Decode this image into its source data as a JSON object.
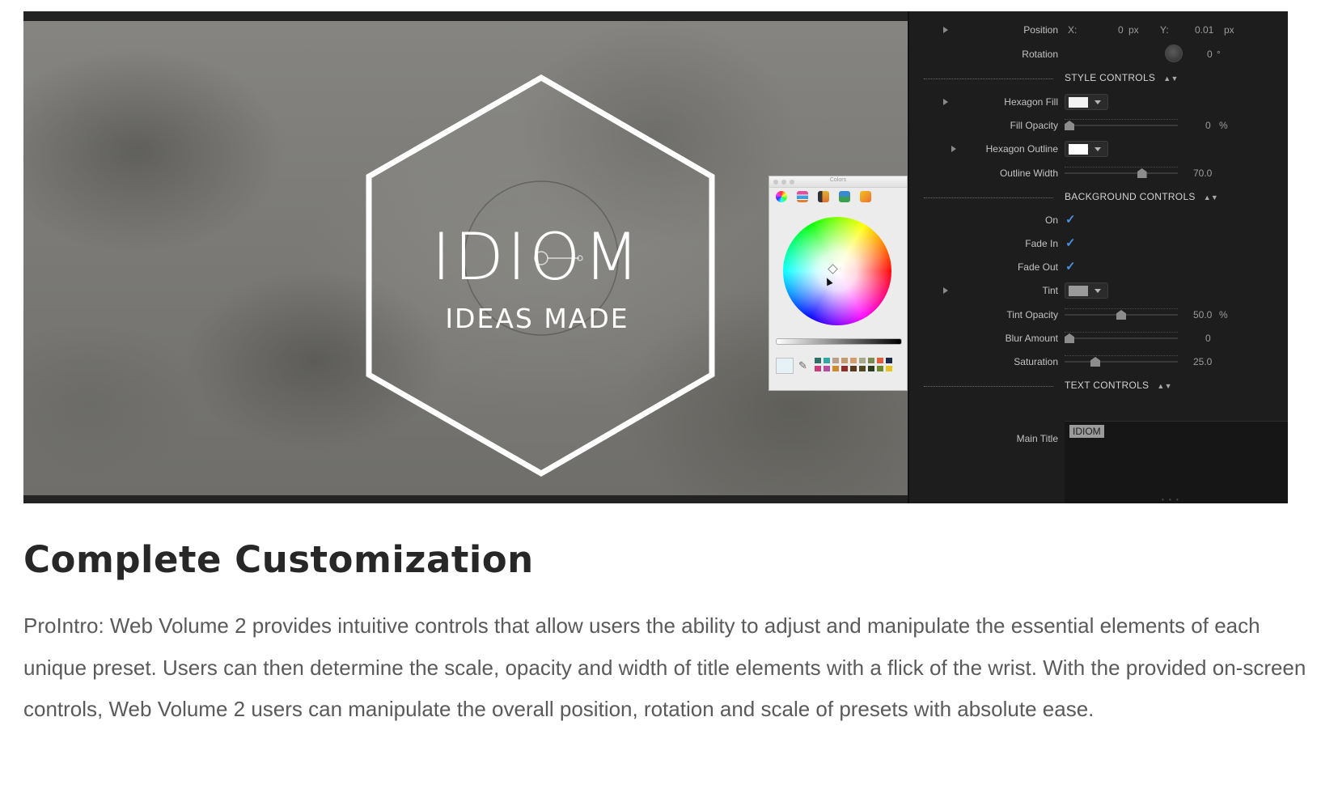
{
  "preview": {
    "brand_title": "IDIOM",
    "brand_subtitle": "IDEAS MADE",
    "colors_panel": {
      "title": "Colors",
      "recent_swatches": [
        "#2f6f6a",
        "#33a7a8",
        "#b9a08c",
        "#c49a73",
        "#d59b6b",
        "#a8a88a",
        "#7b8c52",
        "#e25f3e",
        "#1c2a4a",
        "#c63c7c",
        "#b44ca0",
        "#d08b2d",
        "#8f2f2b",
        "#5b3a1c",
        "#4e4a1f",
        "#2f3c1e",
        "#6c8a2d",
        "#e6c21f"
      ]
    }
  },
  "inspector": {
    "position": {
      "label": "Position",
      "x_label": "X:",
      "x_value": "0",
      "x_unit": "px",
      "y_label": "Y:",
      "y_value": "0.01",
      "y_unit": "px"
    },
    "rotation": {
      "label": "Rotation",
      "value": "0",
      "unit": "°"
    },
    "style_controls": {
      "title": "STYLE CONTROLS",
      "hexagon_fill": {
        "label": "Hexagon Fill",
        "color": "#f2f2f2"
      },
      "fill_opacity": {
        "label": "Fill Opacity",
        "value": "0",
        "unit": "%",
        "fraction": 0.0
      },
      "hexagon_outline": {
        "label": "Hexagon Outline",
        "color": "#ffffff"
      },
      "outline_width": {
        "label": "Outline Width",
        "value": "70.0",
        "fraction": 0.7
      }
    },
    "background_controls": {
      "title": "BACKGROUND CONTROLS",
      "on": {
        "label": "On",
        "checked": true
      },
      "fade_in": {
        "label": "Fade In",
        "checked": true
      },
      "fade_out": {
        "label": "Fade Out",
        "checked": true
      },
      "tint": {
        "label": "Tint",
        "color": "#9a9a9a"
      },
      "tint_opacity": {
        "label": "Tint Opacity",
        "value": "50.0",
        "unit": "%",
        "fraction": 0.5
      },
      "blur_amount": {
        "label": "Blur Amount",
        "value": "0",
        "fraction": 0.0
      },
      "saturation": {
        "label": "Saturation",
        "value": "25.0",
        "fraction": 0.25
      }
    },
    "text_controls": {
      "title": "TEXT CONTROLS",
      "main_title": {
        "label": "Main Title",
        "value": "IDIOM"
      }
    }
  },
  "article": {
    "heading": "Complete Customization",
    "body": "ProIntro: Web Volume 2 provides intuitive controls that allow users the ability to adjust and manipulate the essential elements of each unique preset. Users can then determine the scale, opacity and width of title elements with a flick of the wrist. With the provided on-screen controls, Web Volume 2 users can manipulate the overall position, rotation and scale of presets with absolute ease."
  }
}
